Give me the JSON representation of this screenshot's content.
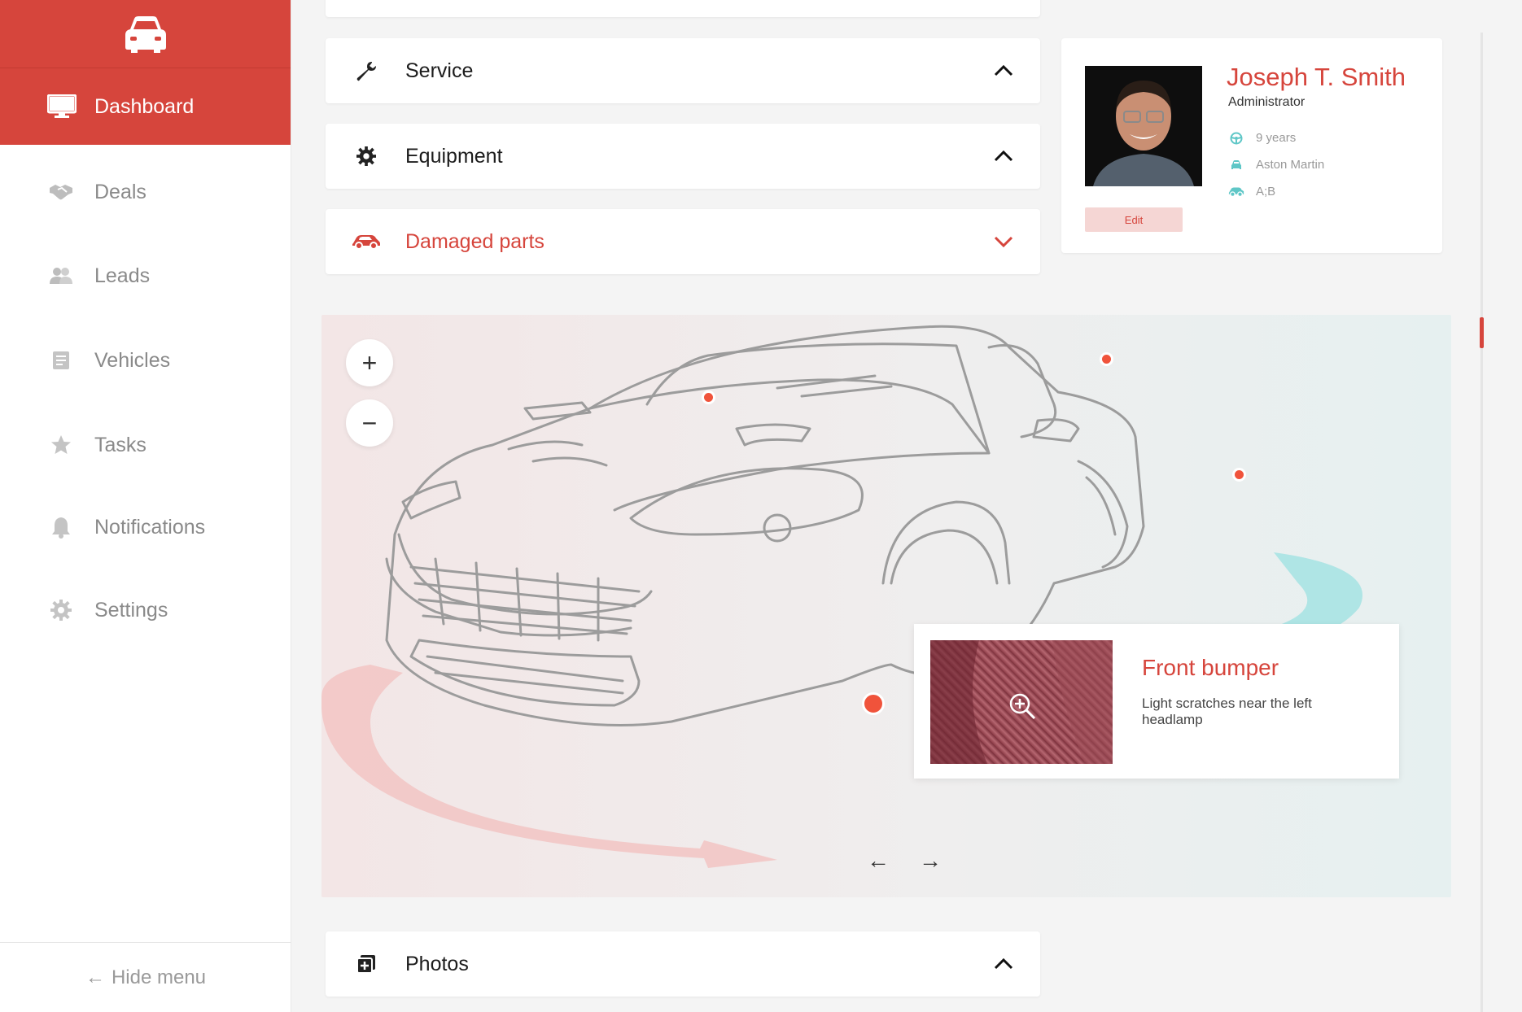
{
  "sidebar": {
    "active": {
      "label": "Dashboard",
      "icon": "monitor-icon"
    },
    "items": [
      {
        "label": "Deals",
        "icon": "handshake-icon"
      },
      {
        "label": "Leads",
        "icon": "users-icon"
      },
      {
        "label": "Vehicles",
        "icon": "document-icon"
      },
      {
        "label": "Tasks",
        "icon": "star-icon"
      },
      {
        "label": "Notifications",
        "icon": "bell-icon"
      },
      {
        "label": "Settings",
        "icon": "gear-icon"
      }
    ],
    "hide_menu": "Hide menu"
  },
  "accordions": {
    "service": "Service",
    "equipment": "Equipment",
    "damaged": "Damaged parts",
    "photos": "Photos"
  },
  "profile": {
    "name": "Joseph T. Smith",
    "role": "Administrator",
    "experience": "9 years",
    "car": "Aston Martin",
    "license": "A;B",
    "edit_label": "Edit"
  },
  "viewer": {
    "zoom_in": "+",
    "zoom_out": "−",
    "prev": "←",
    "next": "→",
    "detail_title": "Front bumper",
    "detail_desc": "Light scratches near the left headlamp"
  },
  "colors": {
    "accent": "#d6453c",
    "hotspot": "#f0533b",
    "teal": "#5fc7c7"
  }
}
